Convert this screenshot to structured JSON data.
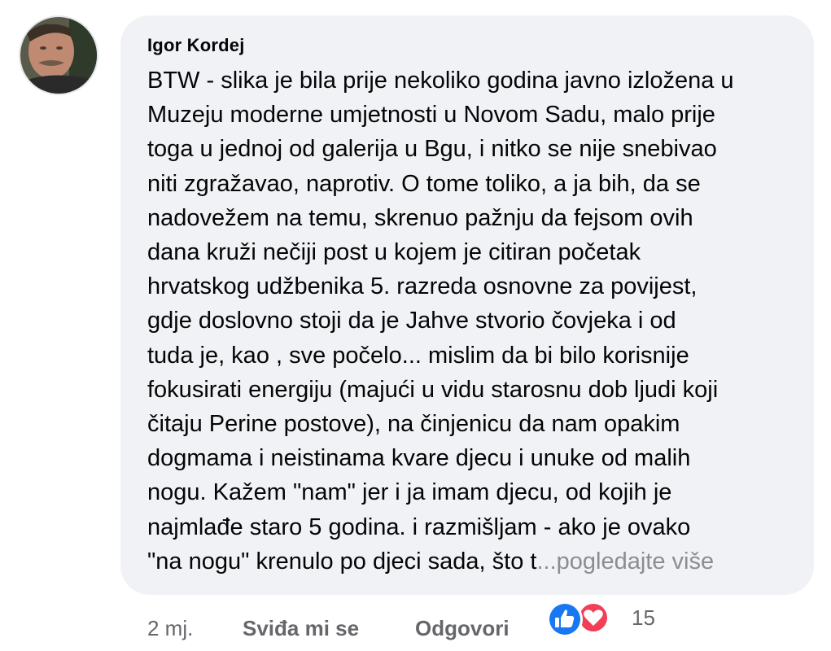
{
  "comment": {
    "author": "Igor Kordej",
    "text": "BTW - slika je bila prije nekoliko godina javno izložena u\nMuzeju moderne umjetnosti u Novom Sadu, malo prije\ntoga u jednoj od galerija u Bgu, i nitko se nije snebivao\nniti zgražavao, naprotiv. O tome toliko,  a ja bih, da se\nnadovežem na temu,  skrenuo pažnju da fejsom ovih\ndana kruži nečiji post u kojem je citiran početak\nhrvatskog udžbenika 5. razreda osnovne za povijest,\ngdje  doslovno stoji da je Jahve stvorio čovjeka i od\ntuda je, kao , sve počelo... mislim da bi bilo korisnije\nfokusirati energiju (majući u vidu starosnu dob ljudi koji\nčitaju Perine postove), na činjenicu da nam opakim\ndogmama i neistinama kvare djecu i unuke od malih\nnogu. Kažem \"nam\" jer i ja imam djecu, od kojih je\nnajmlađe staro 5 godina. i razmišljam - ako je ovako\n\"na nogu\" krenulo  po djeci sada, što t",
    "see_more": "...pogledajte više"
  },
  "actions": {
    "time": "2 mj.",
    "like_label": "Sviđa mi se",
    "reply_label": "Odgovori"
  },
  "reactions": {
    "icons": [
      "like-icon",
      "love-icon"
    ],
    "count": "15",
    "colors": {
      "like": "#1877f2",
      "love": "#f33e58"
    }
  }
}
